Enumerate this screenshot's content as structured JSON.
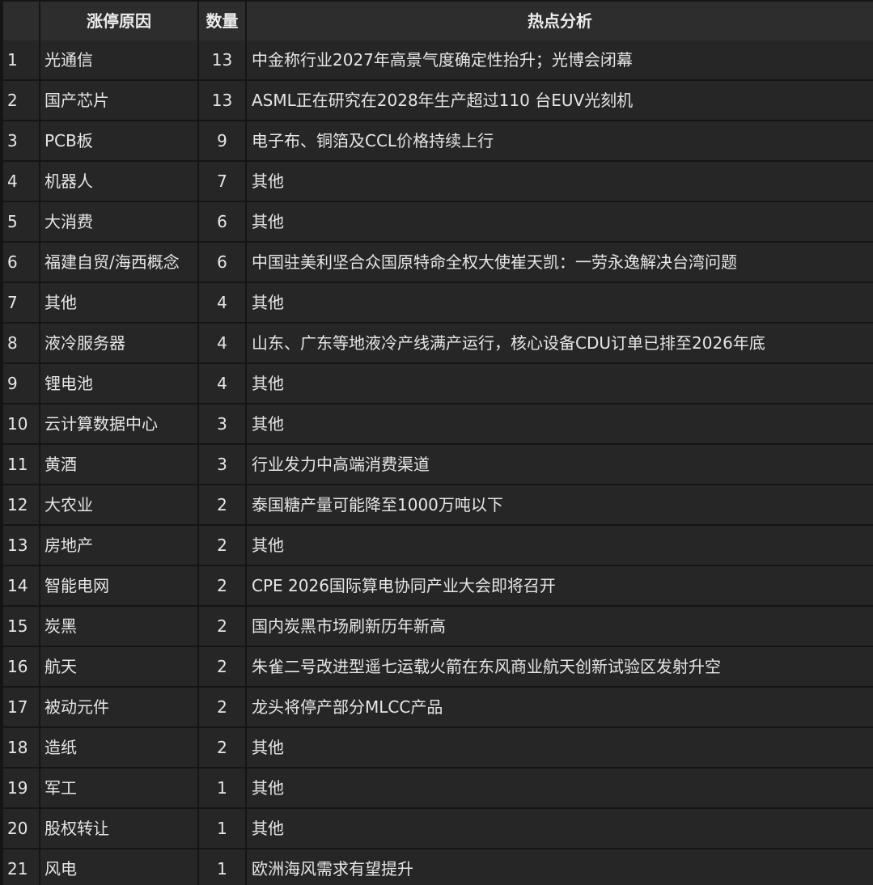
{
  "header": {
    "reason": "涨停原因",
    "count": "数量",
    "analysis": "热点分析"
  },
  "rows": [
    {
      "idx": "1",
      "reason": "光通信",
      "count": "13",
      "analysis": "中金称行业2027年高景气度确定性抬升；光博会闭幕"
    },
    {
      "idx": "2",
      "reason": "国产芯片",
      "count": "13",
      "analysis": "ASML正在研究在2028年生产超过110 台EUV光刻机"
    },
    {
      "idx": "3",
      "reason": "PCB板",
      "count": "9",
      "analysis": "电子布、铜箔及CCL价格持续上行"
    },
    {
      "idx": "4",
      "reason": "机器人",
      "count": "7",
      "analysis": "其他"
    },
    {
      "idx": "5",
      "reason": "大消费",
      "count": "6",
      "analysis": "其他"
    },
    {
      "idx": "6",
      "reason": "福建自贸/海西概念",
      "count": "6",
      "analysis": "中国驻美利坚合众国原特命全权大使崔天凯：一劳永逸解决台湾问题"
    },
    {
      "idx": "7",
      "reason": "其他",
      "count": "4",
      "analysis": "其他"
    },
    {
      "idx": "8",
      "reason": "液冷服务器",
      "count": "4",
      "analysis": "山东、广东等地液冷产线满产运行，核心设备CDU订单已排至2026年底"
    },
    {
      "idx": "9",
      "reason": "锂电池",
      "count": "4",
      "analysis": "其他"
    },
    {
      "idx": "10",
      "reason": "云计算数据中心",
      "count": "3",
      "analysis": "其他"
    },
    {
      "idx": "11",
      "reason": "黄酒",
      "count": "3",
      "analysis": "行业发力中高端消费渠道"
    },
    {
      "idx": "12",
      "reason": "大农业",
      "count": "2",
      "analysis": "泰国糖产量可能降至1000万吨以下"
    },
    {
      "idx": "13",
      "reason": "房地产",
      "count": "2",
      "analysis": "其他"
    },
    {
      "idx": "14",
      "reason": "智能电网",
      "count": "2",
      "analysis": "CPE 2026国际算电协同产业大会即将召开"
    },
    {
      "idx": "15",
      "reason": "炭黑",
      "count": "2",
      "analysis": "国内炭黑市场刷新历年新高"
    },
    {
      "idx": "16",
      "reason": "航天",
      "count": "2",
      "analysis": "朱雀二号改进型遥七运载火箭在东风商业航天创新试验区发射升空"
    },
    {
      "idx": "17",
      "reason": "被动元件",
      "count": "2",
      "analysis": "龙头将停产部分MLCC产品"
    },
    {
      "idx": "18",
      "reason": "造纸",
      "count": "2",
      "analysis": "其他"
    },
    {
      "idx": "19",
      "reason": "军工",
      "count": "1",
      "analysis": "其他"
    },
    {
      "idx": "20",
      "reason": "股权转让",
      "count": "1",
      "analysis": "其他"
    },
    {
      "idx": "21",
      "reason": "风电",
      "count": "1",
      "analysis": "欧洲海风需求有望提升"
    }
  ]
}
